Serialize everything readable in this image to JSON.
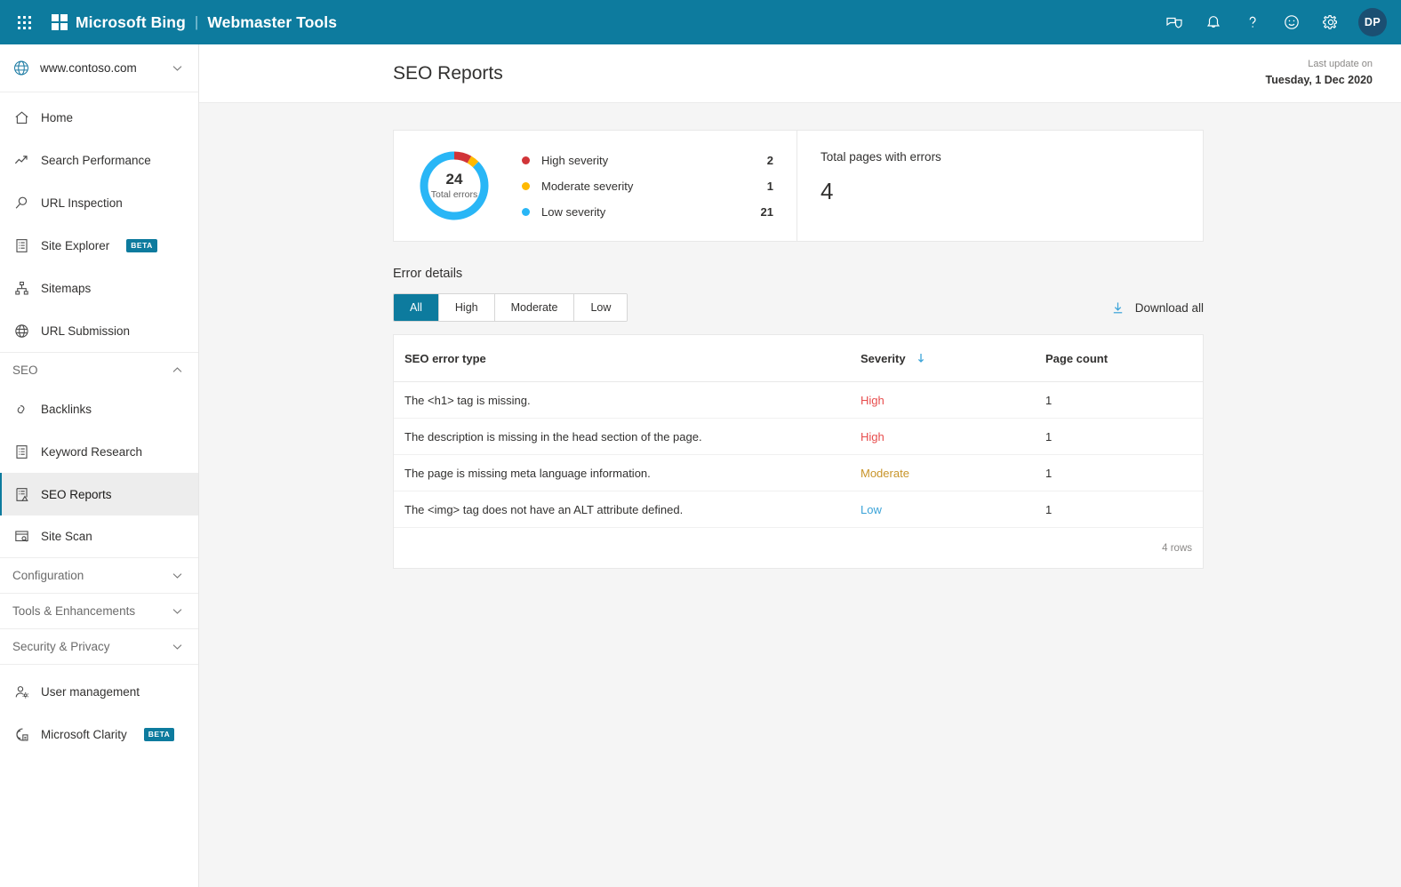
{
  "topbar": {
    "waffle_label": "App launcher",
    "brand_bing": "Microsoft Bing",
    "brand_separator": "|",
    "brand_product": "Webmaster Tools",
    "icons": [
      "feedback-tag-icon",
      "bell-icon",
      "help-icon",
      "smiley-icon",
      "gear-icon"
    ],
    "avatar_initials": "DP"
  },
  "sidebar": {
    "site": {
      "name": "www.contoso.com",
      "icon": "globe-icon"
    },
    "items": [
      {
        "label": "Home",
        "icon": "home-icon",
        "active": false
      },
      {
        "label": "Search Performance",
        "icon": "trend-line-icon",
        "active": false
      },
      {
        "label": "URL Inspection",
        "icon": "magnifier-icon",
        "active": false
      },
      {
        "label": "Site Explorer",
        "icon": "list-document-icon",
        "active": false,
        "badge": "BETA"
      },
      {
        "label": "Sitemaps",
        "icon": "sitemap-icon",
        "active": false
      },
      {
        "label": "URL Submission",
        "icon": "globe-submit-icon",
        "active": false
      }
    ],
    "seo_section": {
      "title": "SEO",
      "expanded": true,
      "chevron": "chevron-up-icon"
    },
    "seo_items": [
      {
        "label": "Backlinks",
        "icon": "links-icon",
        "active": false
      },
      {
        "label": "Keyword Research",
        "icon": "keyword-document-icon",
        "active": false
      },
      {
        "label": "SEO Reports",
        "icon": "report-warning-icon",
        "active": true
      },
      {
        "label": "Site Scan",
        "icon": "scan-window-icon",
        "active": false
      }
    ],
    "sections": [
      {
        "title": "Configuration",
        "chevron": "chevron-down-icon"
      },
      {
        "title": "Tools & Enhancements",
        "chevron": "chevron-down-icon"
      },
      {
        "title": "Security & Privacy",
        "chevron": "chevron-down-icon"
      }
    ],
    "bottom_items": [
      {
        "label": "User management",
        "icon": "user-gear-icon"
      },
      {
        "label": "Microsoft Clarity",
        "icon": "clarity-icon",
        "badge": "BETA"
      }
    ]
  },
  "page": {
    "title": "SEO Reports",
    "last_update_label": "Last update on",
    "last_update_value": "Tuesday, 1 Dec 2020"
  },
  "summary": {
    "donut": {
      "total": "24",
      "total_label": "Total errors"
    },
    "legend": [
      {
        "label": "High severity",
        "value": "2",
        "color": "#d13438"
      },
      {
        "label": "Moderate severity",
        "value": "1",
        "color": "#ffb900"
      },
      {
        "label": "Low severity",
        "value": "21",
        "color": "#29b6f6"
      }
    ],
    "pages_card": {
      "label": "Total pages with errors",
      "value": "4"
    }
  },
  "error_details": {
    "section_title": "Error details",
    "filters": [
      {
        "label": "All",
        "active": true
      },
      {
        "label": "High",
        "active": false
      },
      {
        "label": "Moderate",
        "active": false
      },
      {
        "label": "Low",
        "active": false
      }
    ],
    "download_label": "Download all",
    "download_icon": "download-icon",
    "columns": [
      "SEO error type",
      "Severity",
      "Page count"
    ],
    "sort_column": "Severity",
    "sort_icon": "sort-descending-arrow-icon",
    "rows": [
      {
        "error": "The <h1> tag is missing.",
        "severity": "High",
        "severity_class": "sev-high",
        "page_count": "1"
      },
      {
        "error": "The description is missing in the head section of the page.",
        "severity": "High",
        "severity_class": "sev-high",
        "page_count": "1"
      },
      {
        "error": "The page is missing meta language information.",
        "severity": "Moderate",
        "severity_class": "sev-mod",
        "page_count": "1"
      },
      {
        "error": "The <img> tag does not have an ALT attribute defined.",
        "severity": "Low",
        "severity_class": "sev-low",
        "page_count": "1"
      }
    ],
    "footer_text": "4 rows"
  },
  "chart_data": {
    "type": "pie",
    "title": "Total errors by severity",
    "categories": [
      "High severity",
      "Moderate severity",
      "Low severity"
    ],
    "values": [
      2,
      1,
      21
    ],
    "colors": [
      "#d13438",
      "#ffb900",
      "#29b6f6"
    ],
    "total": 24,
    "center_label": "24 Total errors",
    "legend_position": "right",
    "donut": true
  },
  "theme": {
    "brand_teal": "#0d7b9e",
    "page_bg": "#f5f5f5",
    "high_color": "#e74c4c",
    "moderate_color": "#c8942a",
    "low_color": "#3ba3d8"
  }
}
